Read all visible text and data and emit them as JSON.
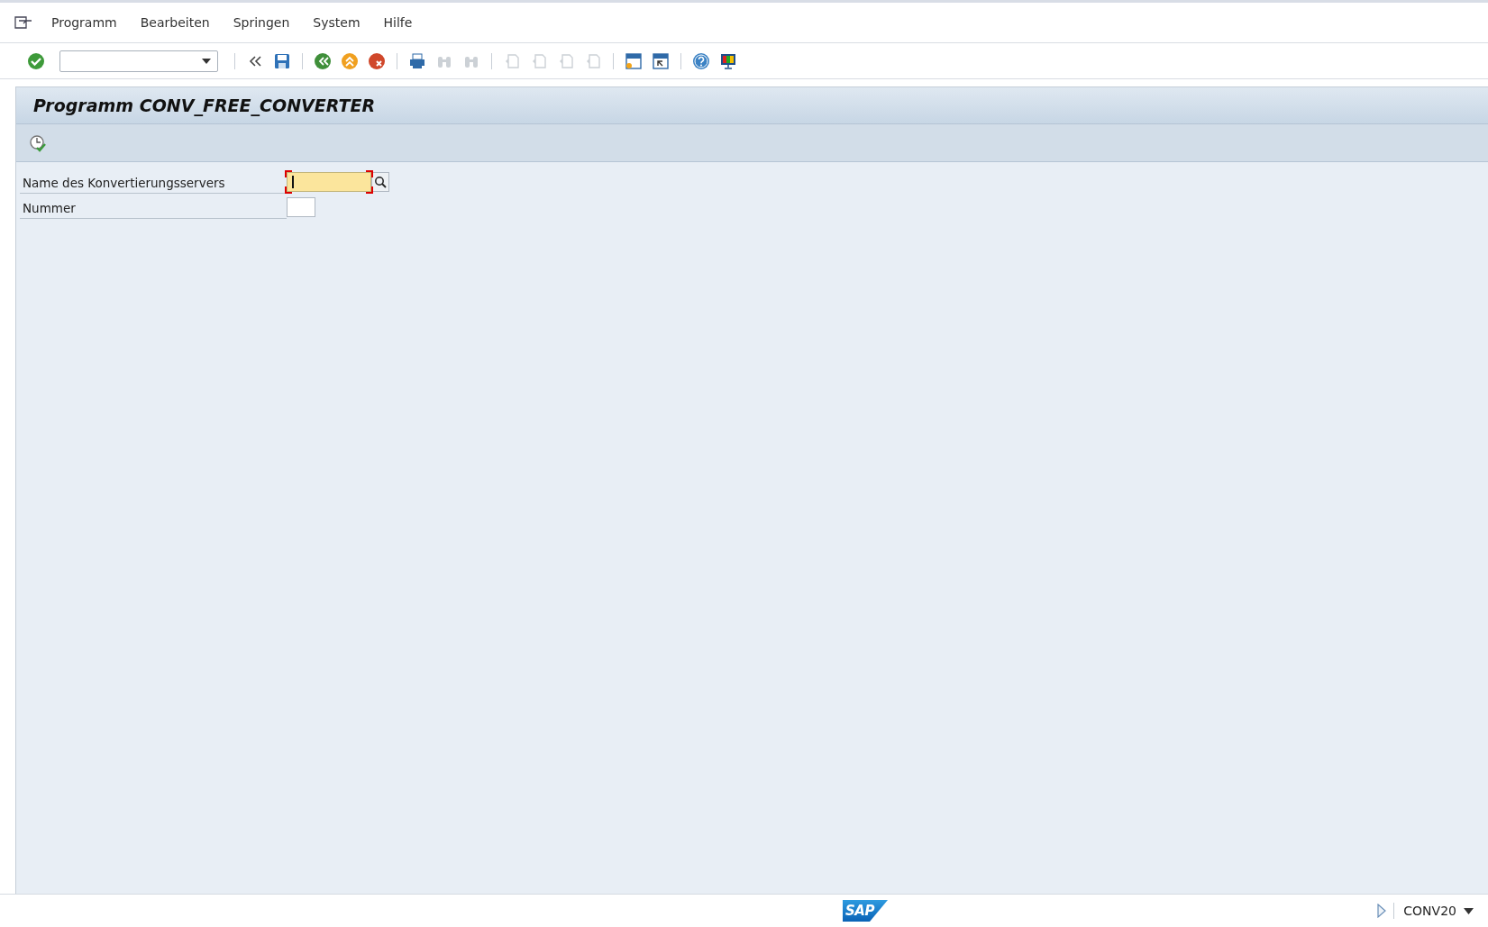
{
  "menu_bar": {
    "items": [
      "Programm",
      "Bearbeiten",
      "Springen",
      "System",
      "Hilfe"
    ]
  },
  "toolbar": {
    "buttons": [
      {
        "kind": "check",
        "disabled": false
      },
      {
        "kind": "sep"
      },
      {
        "kind": "chevrons",
        "disabled": false
      },
      {
        "kind": "save",
        "disabled": false
      },
      {
        "kind": "sep"
      },
      {
        "kind": "back",
        "disabled": false
      },
      {
        "kind": "exit",
        "disabled": false
      },
      {
        "kind": "cancel",
        "disabled": false
      },
      {
        "kind": "sep"
      },
      {
        "kind": "print",
        "disabled": false
      },
      {
        "kind": "find",
        "disabled": true
      },
      {
        "kind": "findnext",
        "disabled": true
      },
      {
        "kind": "sep"
      },
      {
        "kind": "first",
        "disabled": true
      },
      {
        "kind": "prev",
        "disabled": true
      },
      {
        "kind": "next",
        "disabled": true
      },
      {
        "kind": "last",
        "disabled": true
      },
      {
        "kind": "sep"
      },
      {
        "kind": "newsession",
        "disabled": false
      },
      {
        "kind": "shortcut",
        "disabled": false
      },
      {
        "kind": "sep"
      },
      {
        "kind": "help",
        "disabled": false
      },
      {
        "kind": "layout",
        "disabled": false
      }
    ]
  },
  "screen": {
    "title": "Programm CONV_FREE_CONVERTER",
    "fields": [
      {
        "label": "Name des Konvertierungsservers",
        "focused": true,
        "search_help": true
      },
      {
        "label": "Nummer",
        "focused": false,
        "search_help": false
      }
    ]
  },
  "status_bar": {
    "logo": "SAP",
    "system": "CONV20"
  }
}
